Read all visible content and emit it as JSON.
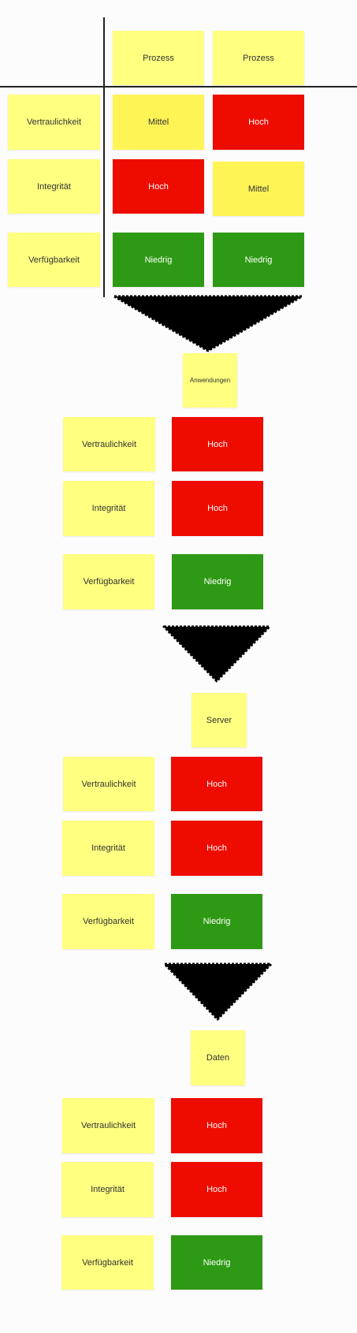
{
  "colors": {
    "note_yellow": "#ffff80",
    "medium_yellow": "#fff456",
    "high_red": "#ee0c00",
    "low_green": "#2e9914"
  },
  "matrix": {
    "columns": [
      "Prozess",
      "Prozess"
    ],
    "rows": [
      {
        "label": "Vertraulichkeit",
        "values": [
          "Mittel",
          "Hoch"
        ]
      },
      {
        "label": "Integrität",
        "values": [
          "Hoch",
          "Mittel"
        ]
      },
      {
        "label": "Verfügbarkeit",
        "values": [
          "Niedrig",
          "Niedrig"
        ]
      }
    ]
  },
  "sections": [
    {
      "title": "Anwendungen",
      "rows": [
        {
          "label": "Vertraulichkeit",
          "value": "Hoch"
        },
        {
          "label": "Integrität",
          "value": "Hoch"
        },
        {
          "label": "Verfügbarkeit",
          "value": "Niedrig"
        }
      ]
    },
    {
      "title": "Server",
      "rows": [
        {
          "label": "Vertraulichkeit",
          "value": "Hoch"
        },
        {
          "label": "Integrität",
          "value": "Hoch"
        },
        {
          "label": "Verfügbarkeit",
          "value": "Niedrig"
        }
      ]
    },
    {
      "title": "Daten",
      "rows": [
        {
          "label": "Vertraulichkeit",
          "value": "Hoch"
        },
        {
          "label": "Integrität",
          "value": "Hoch"
        },
        {
          "label": "Verfügbarkeit",
          "value": "Niedrig"
        }
      ]
    }
  ]
}
